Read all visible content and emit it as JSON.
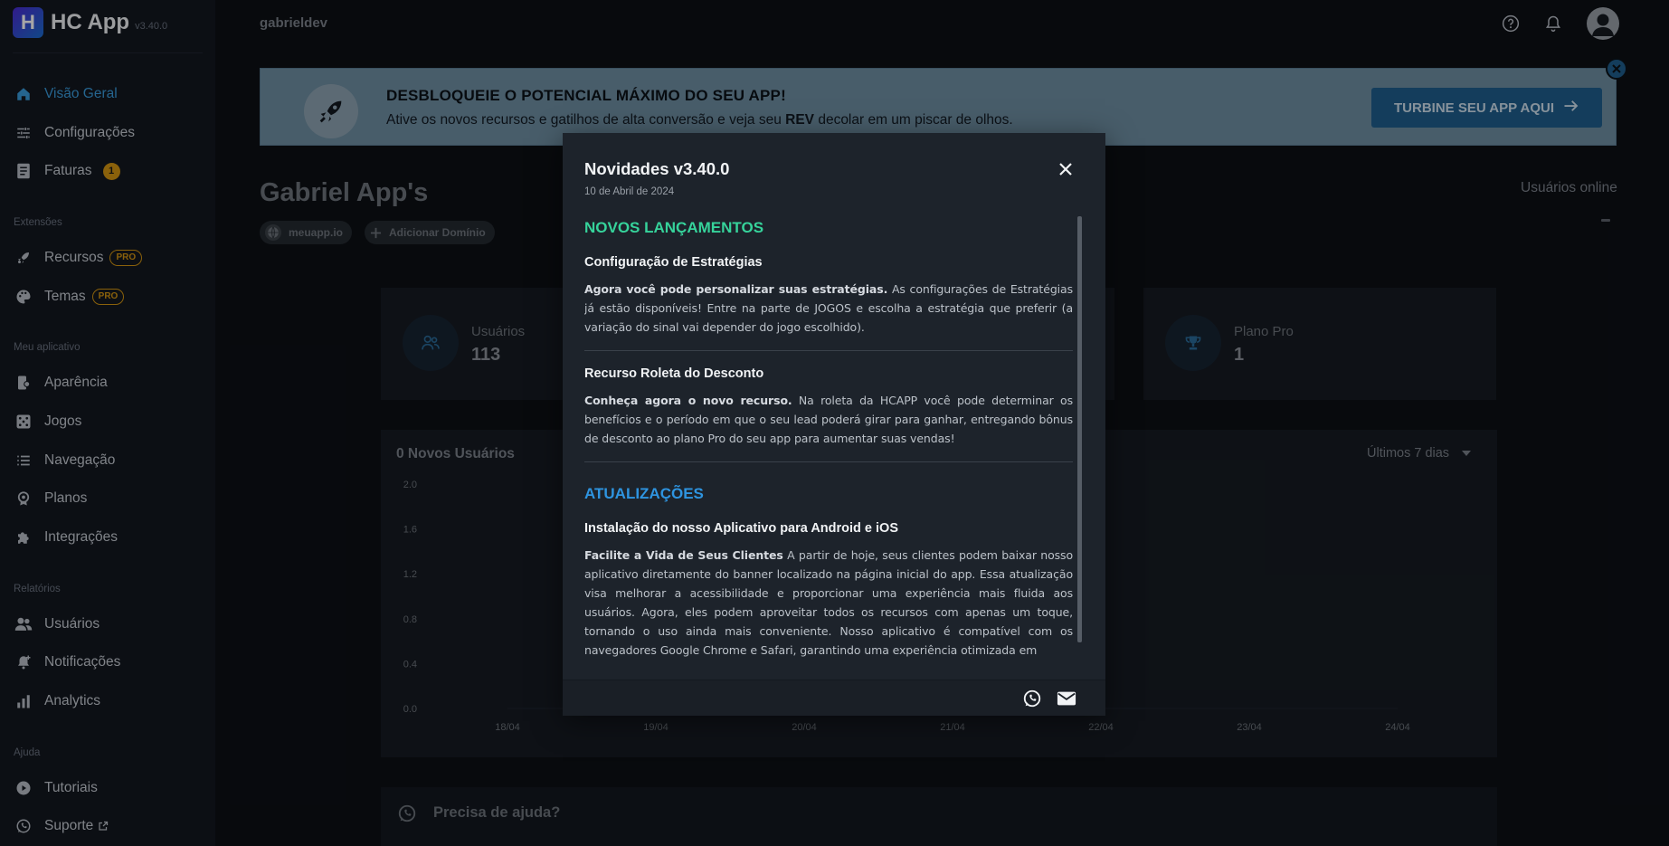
{
  "app": {
    "name": "HC App",
    "version": "v3.40.0"
  },
  "sidebar": {
    "main": [
      {
        "label": "Visão Geral",
        "icon": "home-icon",
        "active": true
      },
      {
        "label": "Configurações",
        "icon": "sliders-icon"
      },
      {
        "label": "Faturas",
        "icon": "invoice-icon",
        "badge": "1"
      }
    ],
    "sections": [
      {
        "title": "Extensões",
        "items": [
          {
            "label": "Recursos",
            "icon": "rocket-icon",
            "pro": "PRO"
          },
          {
            "label": "Temas",
            "icon": "palette-icon",
            "pro": "PRO"
          }
        ]
      },
      {
        "title": "Meu aplicativo",
        "items": [
          {
            "label": "Aparência",
            "icon": "appearance-icon"
          },
          {
            "label": "Jogos",
            "icon": "dice-icon"
          },
          {
            "label": "Navegação",
            "icon": "list-icon"
          },
          {
            "label": "Planos",
            "icon": "badge-icon"
          },
          {
            "label": "Integrações",
            "icon": "puzzle-icon"
          }
        ]
      },
      {
        "title": "Relatórios",
        "items": [
          {
            "label": "Usuários",
            "icon": "users-icon"
          },
          {
            "label": "Notificações",
            "icon": "bell-plus-icon"
          },
          {
            "label": "Analytics",
            "icon": "bar-chart-icon"
          }
        ]
      },
      {
        "title": "Ajuda",
        "items": [
          {
            "label": "Tutoriais",
            "icon": "play-circle-icon"
          },
          {
            "label": "Suporte",
            "icon": "whatsapp-icon"
          }
        ]
      }
    ]
  },
  "topbar": {
    "username": "gabrieldev",
    "icons": [
      "help-icon",
      "bell-icon",
      "avatar-icon"
    ]
  },
  "promo": {
    "title": "DESBLOQUEIE O POTENCIAL MÁXIMO DO SEU APP!",
    "text_before": "Ative os novos recursos e gatilhos de alta conversão e veja seu ",
    "text_bold": "REV",
    "text_after": " decolar em um piscar de olhos.",
    "button": "TURBINE SEU APP AQUI",
    "colors": {
      "banner": "#6f8fa4",
      "button": "#1f5f8e"
    }
  },
  "page": {
    "title": "Gabriel App's",
    "domain_chip": "meuapp.io",
    "add_domain_chip": "Adicionar Domínio",
    "online_label": "Usuários online"
  },
  "stats": [
    {
      "label": "Usuários",
      "value": "113",
      "icon": "users-icon"
    },
    {
      "label": "Plano Pro",
      "value": "1",
      "icon": "trophy-icon"
    }
  ],
  "chart": {
    "title": "0 Novos Usuários",
    "range": "Últimos 7 dias"
  },
  "chart_data": {
    "type": "line",
    "title": "0 Novos Usuários",
    "x": [
      "18/04",
      "19/04",
      "20/04",
      "21/04",
      "22/04",
      "23/04",
      "24/04"
    ],
    "series": [
      {
        "values": [
          0,
          0,
          0,
          0,
          0,
          0,
          0
        ]
      }
    ],
    "y_ticks": [
      "0.0",
      "0.4",
      "0.8",
      "1.2",
      "1.6",
      "2.0"
    ],
    "ylim": [
      0,
      2
    ],
    "grid": false
  },
  "help": {
    "text": "Precisa de ajuda?"
  },
  "modal": {
    "title": "Novidades v3.40.0",
    "date": "10 de Abril de 2024",
    "sections": [
      {
        "title": "NOVOS LANÇAMENTOS",
        "color": "#36d39b",
        "items": [
          {
            "title": "Configuração de Estratégias",
            "lead": "Agora você pode personalizar suas estratégias.",
            "text": " As configurações de Estratégias já estão disponíveis! Entre na parte de JOGOS e escolha a estratégia que preferir (a variação do sinal vai depender do jogo escolhido)."
          },
          {
            "title": "Recurso Roleta do Desconto",
            "lead": "Conheça agora o novo recurso.",
            "text": " Na roleta da HCAPP você pode determinar os benefícios e o período em que o seu lead poderá girar para ganhar, entregando bônus de desconto ao plano Pro do seu app para aumentar suas vendas!"
          }
        ]
      },
      {
        "title": "ATUALIZAÇÕES",
        "color": "#2e94e0",
        "items": [
          {
            "title": "Instalação do nosso Aplicativo para Android e iOS",
            "lead": "Facilite a Vida de Seus Clientes",
            "text": " A partir de hoje, seus clientes podem baixar nosso aplicativo diretamente do banner localizado na página inicial do app. Essa atualização visa melhorar a acessibilidade e proporcionar uma experiência mais fluida aos usuários. Agora, eles podem aproveitar todos os recursos com apenas um toque, tornando o uso ainda mais conveniente. Nosso aplicativo é compatível com os navegadores Google Chrome e Safari, garantindo uma experiência otimizada em"
          }
        ]
      }
    ],
    "footer_icons": [
      "whatsapp-icon",
      "mail-icon"
    ]
  }
}
